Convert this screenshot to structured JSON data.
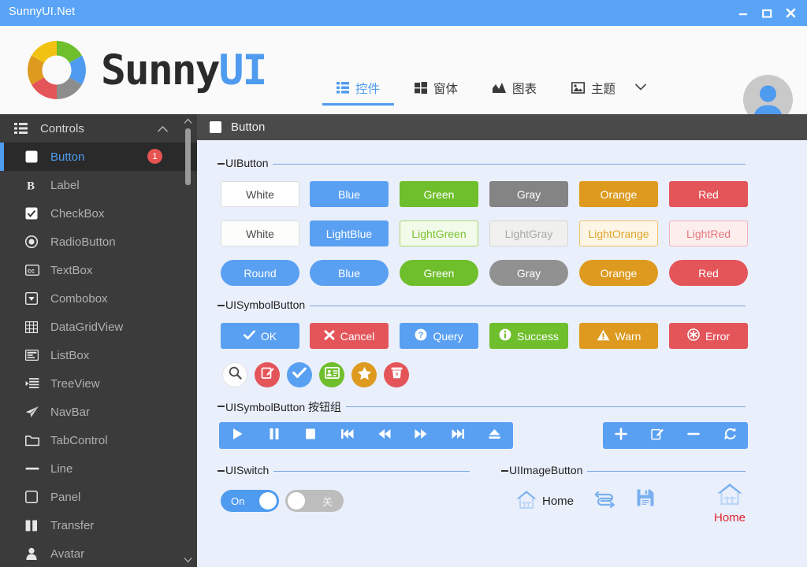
{
  "window": {
    "title": "SunnyUI.Net",
    "titlebar_color": "#5AA4F8",
    "minimize_label": "Minimize",
    "maximize_label": "Maximize",
    "close_label": "Close"
  },
  "brand": {
    "part1": "Sunny",
    "part2": "UI"
  },
  "nav": {
    "tabs": [
      {
        "label": "控件",
        "icon": "list-grid-icon",
        "active": true
      },
      {
        "label": "窗体",
        "icon": "windows-icon",
        "active": false
      },
      {
        "label": "图表",
        "icon": "chart-icon",
        "active": false
      },
      {
        "label": "主题",
        "icon": "image-icon",
        "active": false
      }
    ],
    "more_icon": "chevron-down-icon",
    "avatar_icon": "user-avatar-icon",
    "accent_color": "#4e9bf0"
  },
  "sidebar": {
    "header": {
      "label": "Controls",
      "icon": "list-icon",
      "chevron": "chevron-up-icon"
    },
    "items": [
      {
        "label": "Button",
        "icon": "square-icon",
        "selected": true,
        "badge": "1"
      },
      {
        "label": "Label",
        "icon": "bold-b-icon",
        "selected": false,
        "badge": ""
      },
      {
        "label": "CheckBox",
        "icon": "checkbox-icon",
        "selected": false,
        "badge": ""
      },
      {
        "label": "RadioButton",
        "icon": "radio-icon",
        "selected": false,
        "badge": ""
      },
      {
        "label": "TextBox",
        "icon": "textbox-cc-icon",
        "selected": false,
        "badge": ""
      },
      {
        "label": "Combobox",
        "icon": "combobox-icon",
        "selected": false,
        "badge": ""
      },
      {
        "label": "DataGridView",
        "icon": "grid-table-icon",
        "selected": false,
        "badge": ""
      },
      {
        "label": "ListBox",
        "icon": "listbox-icon",
        "selected": false,
        "badge": ""
      },
      {
        "label": "TreeView",
        "icon": "treeview-icon",
        "selected": false,
        "badge": ""
      },
      {
        "label": "NavBar",
        "icon": "paper-plane-icon",
        "selected": false,
        "badge": ""
      },
      {
        "label": "TabControl",
        "icon": "folder-icon",
        "selected": false,
        "badge": ""
      },
      {
        "label": "Line",
        "icon": "line-icon",
        "selected": false,
        "badge": ""
      },
      {
        "label": "Panel",
        "icon": "panel-square-icon",
        "selected": false,
        "badge": ""
      },
      {
        "label": "Transfer",
        "icon": "transfer-icon",
        "selected": false,
        "badge": ""
      },
      {
        "label": "Avatar",
        "icon": "person-icon",
        "selected": false,
        "badge": ""
      }
    ],
    "scrollbar": {
      "up_icon": "scroll-up-icon",
      "down_icon": "scroll-down-icon"
    }
  },
  "content_tab": {
    "label": "Button",
    "icon": "square-icon"
  },
  "groups": {
    "uibutton": "UIButton",
    "uisymbolbutton": "UISymbolButton",
    "uisymbolbutton_group": "UISymbolButton 按钮组",
    "uiswitch": "UISwitch",
    "uiimagebutton": "UIImageButton"
  },
  "buttons": {
    "row_solid": [
      {
        "label": "White",
        "bg": "#ffffff",
        "fg": "#4a4a4a",
        "border": "#dcdcdc"
      },
      {
        "label": "Blue",
        "bg": "#5aa0f2",
        "fg": "#ffffff",
        "border": "#5aa0f2"
      },
      {
        "label": "Green",
        "bg": "#6fbe2c",
        "fg": "#ffffff",
        "border": "#6fbe2c"
      },
      {
        "label": "Gray",
        "bg": "#848484",
        "fg": "#ffffff",
        "border": "#848484"
      },
      {
        "label": "Orange",
        "bg": "#dd9a1f",
        "fg": "#ffffff",
        "border": "#dd9a1f"
      },
      {
        "label": "Red",
        "bg": "#e4555a",
        "fg": "#ffffff",
        "border": "#e4555a"
      }
    ],
    "row_light": [
      {
        "label": "White",
        "bg": "#fdfdfb",
        "fg": "#4a4a4a",
        "border": "#dcdcdc"
      },
      {
        "label": "LightBlue",
        "bg": "#5aa0f2",
        "fg": "#ffffff",
        "border": "#5aa0f2"
      },
      {
        "label": "LightGreen",
        "bg": "#f2fae9",
        "fg": "#7cc232",
        "border": "#a8d96c"
      },
      {
        "label": "LightGray",
        "bg": "#f0f0ee",
        "fg": "#a8a8a8",
        "border": "#d7d7d5"
      },
      {
        "label": "LightOrange",
        "bg": "#fdf6e6",
        "fg": "#e0a52c",
        "border": "#eec46a"
      },
      {
        "label": "LightRed",
        "bg": "#fdeeee",
        "fg": "#e4787c",
        "border": "#f0b4b6"
      }
    ],
    "row_round": [
      {
        "label": "Round",
        "bg": "#5aa0f2",
        "fg": "#ffffff"
      },
      {
        "label": "Blue",
        "bg": "#5aa0f2",
        "fg": "#ffffff"
      },
      {
        "label": "Green",
        "bg": "#6fbe2c",
        "fg": "#ffffff"
      },
      {
        "label": "Gray",
        "bg": "#919191",
        "fg": "#ffffff"
      },
      {
        "label": "Orange",
        "bg": "#dd9a1f",
        "fg": "#ffffff"
      },
      {
        "label": "Red",
        "bg": "#e4555a",
        "fg": "#ffffff"
      }
    ]
  },
  "symbol_buttons": [
    {
      "label": "OK",
      "icon": "check-icon",
      "bg": "#5aa0f2"
    },
    {
      "label": "Cancel",
      "icon": "x-icon",
      "bg": "#e4555a"
    },
    {
      "label": "Query",
      "icon": "question-icon",
      "bg": "#5aa0f2"
    },
    {
      "label": "Success",
      "icon": "info-icon",
      "bg": "#6fbe2c"
    },
    {
      "label": "Warn",
      "icon": "warning-icon",
      "bg": "#dd9a1f"
    },
    {
      "label": "Error",
      "icon": "error-icon",
      "bg": "#e4555a"
    }
  ],
  "circle_buttons": [
    {
      "icon": "search-icon",
      "bg": "#fdfdfd",
      "fg": "#4a4a4a",
      "border": "#e2e2e2"
    },
    {
      "icon": "edit-note-icon",
      "bg": "#e4555a",
      "fg": "#ffffff",
      "border": "#e4555a"
    },
    {
      "icon": "check-icon",
      "bg": "#5aa0f2",
      "fg": "#ffffff",
      "border": "#5aa0f2"
    },
    {
      "icon": "id-card-icon",
      "bg": "#6fbe2c",
      "fg": "#ffffff",
      "border": "#6fbe2c"
    },
    {
      "icon": "star-icon",
      "bg": "#dd9a1f",
      "fg": "#ffffff",
      "border": "#dd9a1f"
    },
    {
      "icon": "trash-icon",
      "bg": "#e4555a",
      "fg": "#ffffff",
      "border": "#e4555a"
    }
  ],
  "media_group": [
    {
      "icon": "play-icon"
    },
    {
      "icon": "pause-icon"
    },
    {
      "icon": "stop-icon"
    },
    {
      "icon": "skip-start-icon"
    },
    {
      "icon": "rewind-icon"
    },
    {
      "icon": "fast-forward-icon"
    },
    {
      "icon": "skip-end-icon"
    },
    {
      "icon": "eject-icon"
    }
  ],
  "edit_group": [
    {
      "icon": "plus-icon"
    },
    {
      "icon": "edit-square-icon"
    },
    {
      "icon": "minus-icon"
    },
    {
      "icon": "refresh-icon"
    }
  ],
  "switches": [
    {
      "text": "On",
      "state": "on",
      "on_color": "#4e9bf0"
    },
    {
      "text": "关",
      "state": "off",
      "off_color": "#bdbdbd"
    }
  ],
  "image_buttons": [
    {
      "icon": "home-icon",
      "label": "Home",
      "label_color": "#222222"
    },
    {
      "icon": "swap-arrows-icon",
      "label": ""
    },
    {
      "icon": "save-floppy-icon",
      "label": ""
    },
    {
      "icon": "home-icon",
      "label": "Home",
      "label_color": "#e0252b"
    }
  ]
}
